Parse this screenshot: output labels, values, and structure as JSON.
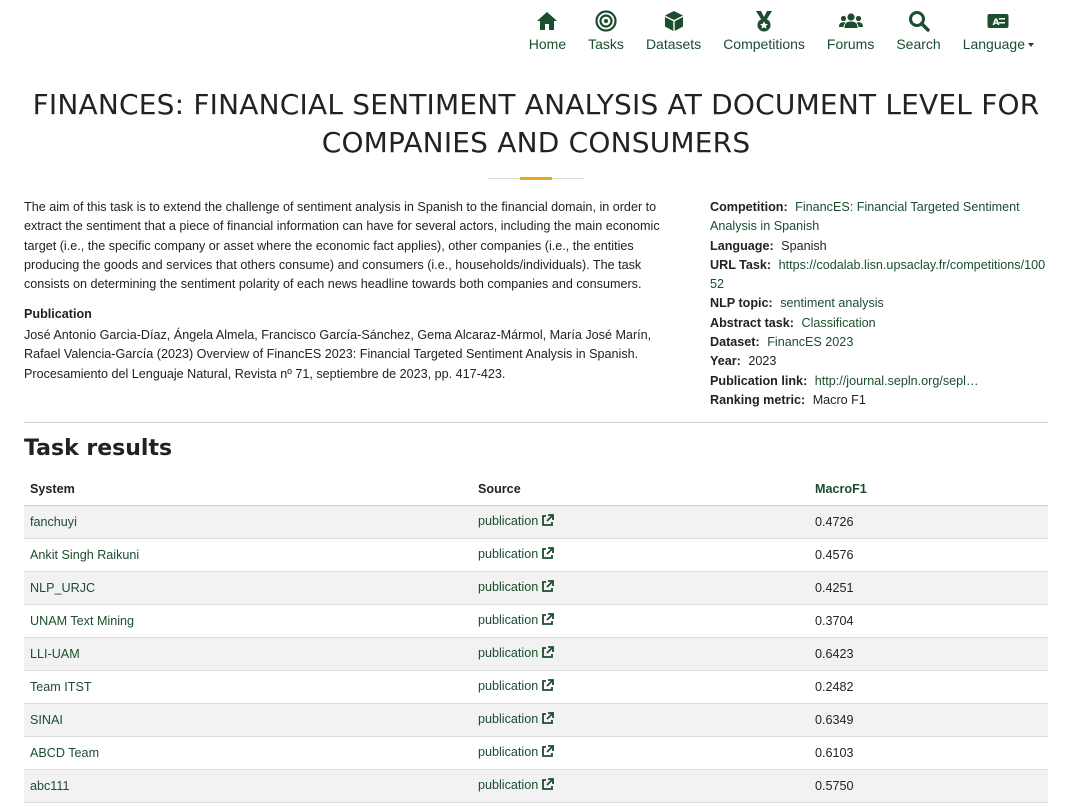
{
  "nav": {
    "items": [
      {
        "label": "Home",
        "icon": "home-icon"
      },
      {
        "label": "Tasks",
        "icon": "target-icon"
      },
      {
        "label": "Datasets",
        "icon": "cube-icon"
      },
      {
        "label": "Competitions",
        "icon": "medal-icon"
      },
      {
        "label": "Forums",
        "icon": "users-icon"
      },
      {
        "label": "Search",
        "icon": "search-icon"
      },
      {
        "label": "Language",
        "icon": "language-icon"
      }
    ]
  },
  "colors": {
    "brand": "#1b4d2e",
    "accent": "#e6a817",
    "row_stripe": "#f2f2f2"
  },
  "title": "FINANCES: FINANCIAL SENTIMENT ANALYSIS AT DOCUMENT LEVEL FOR COMPANIES AND CONSUMERS",
  "description": "The aim of this task is to extend the challenge of sentiment analysis in Spanish to the financial domain, in order to extract the sentiment that a piece of financial information can have for several actors, including the main economic target (i.e., the specific company or asset where the economic fact applies), other companies (i.e., the entities producing the goods and services that others consume) and consumers (i.e., households/individuals). The task consists on determining the sentiment polarity of each news headline towards both companies and consumers.",
  "publication": {
    "heading": "Publication",
    "text": "José Antonio Garcia-Díaz, Ángela Almela, Francisco García-Sánchez, Gema Alcaraz-Mármol, María José Marín, Rafael Valencia-García (2023) Overview of FinancES 2023: Financial Targeted Sentiment Analysis in Spanish. Procesamiento del Lenguaje Natural, Revista nº 71, septiembre de 2023, pp. 417-423."
  },
  "meta": {
    "competition": {
      "key": "Competition:",
      "value": "FinancES: Financial Targeted Sentiment Analysis in Spanish"
    },
    "language": {
      "key": "Language:",
      "value": "Spanish"
    },
    "url_task": {
      "key": "URL Task:",
      "value": "https://codalab.lisn.upsaclay.fr/competitions/10052"
    },
    "nlp_topic": {
      "key": "NLP topic:",
      "value": "sentiment analysis"
    },
    "abstract_task": {
      "key": "Abstract task:",
      "value": "Classification"
    },
    "dataset": {
      "key": "Dataset:",
      "value": "FinancES 2023"
    },
    "year": {
      "key": "Year:",
      "value": "2023"
    },
    "publication_link": {
      "key": "Publication link:",
      "value": "http://journal.sepln.org/sepl…"
    },
    "ranking_metric": {
      "key": "Ranking metric:",
      "value": "Macro F1"
    }
  },
  "results": {
    "title": "Task results",
    "columns": [
      "System",
      "Source",
      "MacroF1"
    ],
    "rows": [
      {
        "system": "fanchuyi",
        "source": "publication",
        "score": "0.4726"
      },
      {
        "system": "Ankit Singh Raikuni",
        "source": "publication",
        "score": "0.4576"
      },
      {
        "system": "NLP_URJC",
        "source": "publication",
        "score": "0.4251"
      },
      {
        "system": "UNAM Text Mining",
        "source": "publication",
        "score": "0.3704"
      },
      {
        "system": "LLI-UAM",
        "source": "publication",
        "score": "0.6423"
      },
      {
        "system": "Team ITST",
        "source": "publication",
        "score": "0.2482"
      },
      {
        "system": "SINAI",
        "source": "publication",
        "score": "0.6349"
      },
      {
        "system": "ABCD Team",
        "source": "publication",
        "score": "0.6103"
      },
      {
        "system": "abc111",
        "source": "publication",
        "score": "0.5750"
      }
    ]
  }
}
